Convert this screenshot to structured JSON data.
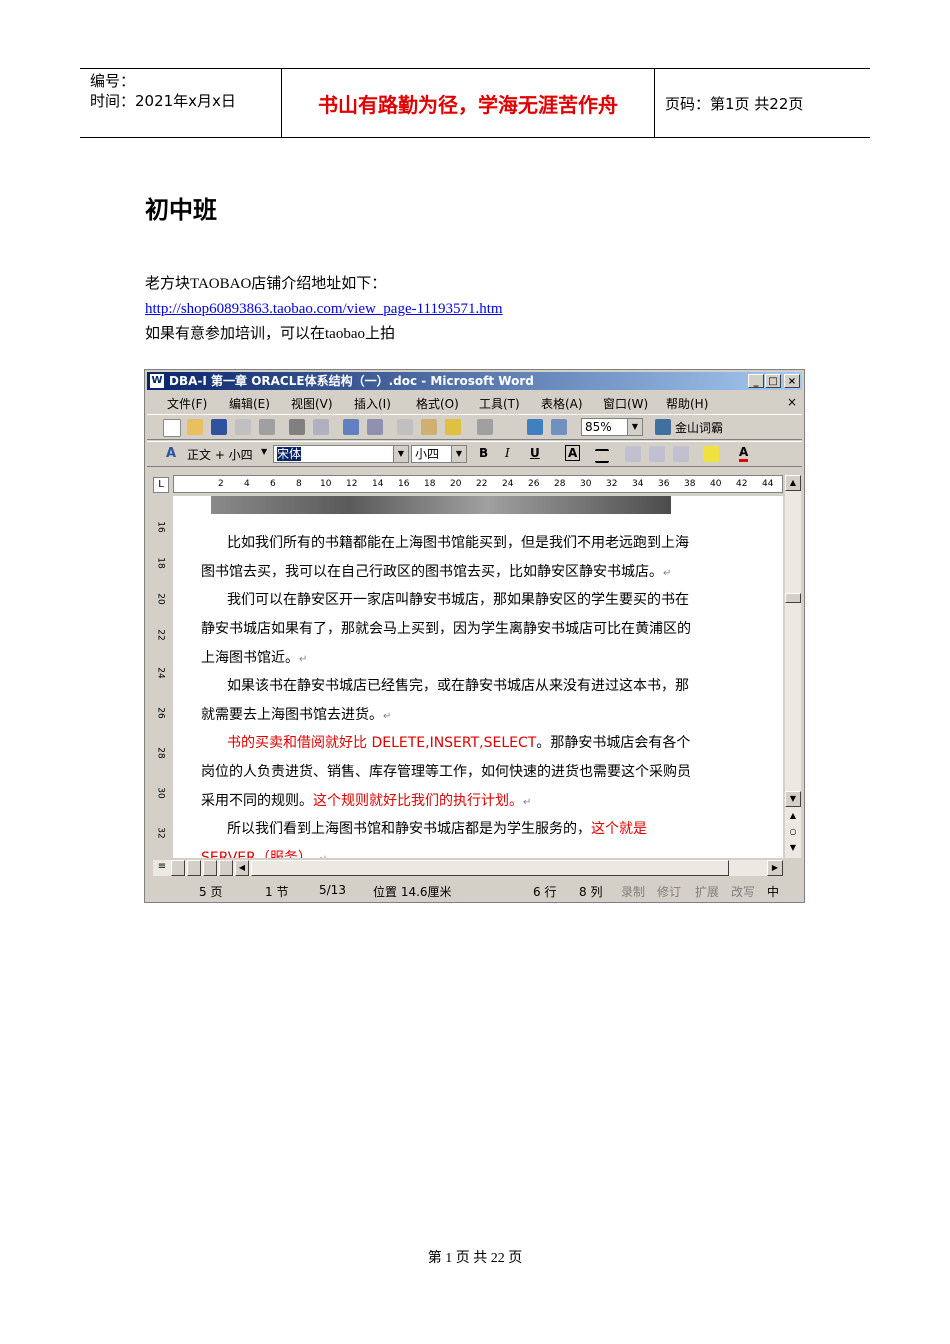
{
  "header": {
    "serial_label": "编号：",
    "time_label": "时间：2021年x月x日",
    "motto": "书山有路勤为径，学海无涯苦作舟",
    "page_info": "页码：第1页  共22页"
  },
  "title": "初中班",
  "intro": {
    "line1": "老方块TAOBAO店铺介绍地址如下：",
    "link": "http://shop60893863.taobao.com/view_page-11193571.htm",
    "line3": "如果有意参加培训，可以在taobao上拍"
  },
  "window": {
    "title": "DBA-I 第一章 ORACLE体系结构（一）.doc - Microsoft Word",
    "controls": {
      "minimize": "_",
      "maximize": "□",
      "close": "×"
    },
    "menu": [
      "文件(F)",
      "编辑(E)",
      "视图(V)",
      "插入(I)",
      "格式(O)",
      "工具(T)",
      "表格(A)",
      "窗口(W)",
      "帮助(H)"
    ],
    "menu_close": "×",
    "toolbar": {
      "zoom": "85%",
      "dictionary": "金山词霸"
    },
    "format_bar": {
      "style": "正文 + 小四",
      "font": "宋体",
      "size": "小四",
      "bold": "B",
      "italic": "I",
      "underline": "U",
      "char_border": "A",
      "font_color": "A"
    },
    "ruler_numbers": [
      "2",
      "4",
      "6",
      "8",
      "10",
      "12",
      "14",
      "16",
      "18",
      "20",
      "22",
      "24",
      "26",
      "28",
      "30",
      "32",
      "34",
      "36",
      "38",
      "40",
      "42",
      "44"
    ],
    "vruler_numbers": [
      "16",
      "18",
      "20",
      "22",
      "24",
      "26",
      "28",
      "30",
      "32"
    ],
    "document": {
      "p1a": "比如我们所有的书籍都能在上海图书馆能买到，但是我们不用老远跑到上海",
      "p1b": "图书馆去买，我可以在自己行政区的图书馆去买，比如静安区静安书城店。",
      "p2a": "我们可以在静安区开一家店叫静安书城店，那如果静安区的学生要买的书在",
      "p2b": "静安书城店如果有了，那就会马上买到，因为学生离静安书城店可比在黄浦区的",
      "p2c": "上海图书馆近。",
      "p3a": "如果该书在静安书城店已经售完，或在静安书城店从来没有进过这本书，那",
      "p3b": "就需要去上海图书馆去进货。",
      "p4a_red": "书的买卖和借阅就好比 DELETE,INSERT,SELECT",
      "p4a_black": "。那静安书城店会有各个",
      "p4b": "岗位的人负责进货、销售、库存管理等工作，如何快速的进货也需要这个采购员",
      "p4c_black": "采用不同的规则。",
      "p4c_red": "这个规则就好比我们的执行计划。",
      "p5a_black": "所以我们看到上海图书馆和静安书城店都是为学生服务的，",
      "p5a_red": "这个就是",
      "p5b_red": "SERVER（服务）。",
      "return_mark": "↵"
    },
    "status": {
      "page": "5 页",
      "section": "1 节",
      "page_of": "5/13",
      "position": "位置 14.6厘米",
      "line": "6 行",
      "column": "8 列",
      "rec": "录制",
      "trk": "修订",
      "ext": "扩展",
      "ovr": "改写",
      "lang": "中"
    }
  },
  "footer": "第 1 页 共 22 页"
}
